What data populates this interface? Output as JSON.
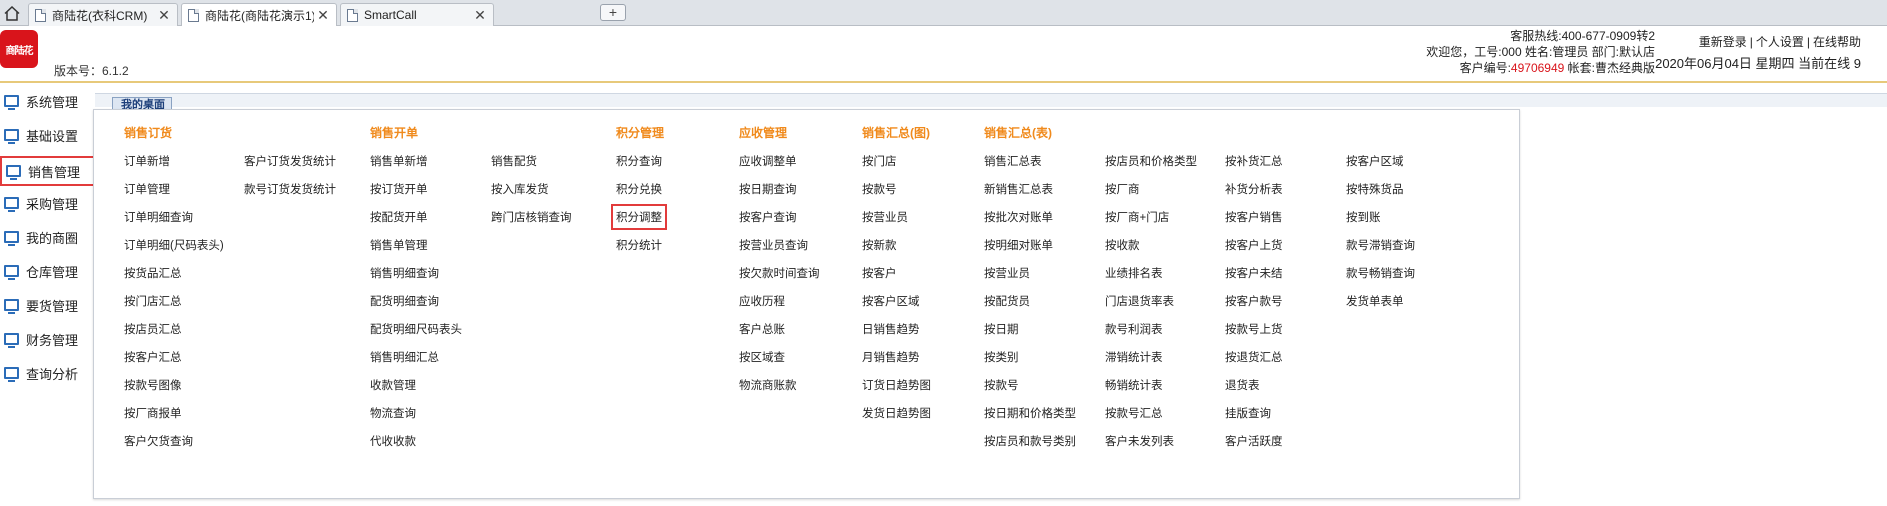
{
  "browser": {
    "tabs": [
      {
        "label": "商陆花(衣科CRM)"
      },
      {
        "label": "商陆花(商陆花演示1)"
      },
      {
        "label": "SmartCall"
      }
    ],
    "new_tab": "+"
  },
  "header": {
    "logo_text": "商陆花",
    "version": "版本号：6.1.2",
    "hotline": "客服热线:400-677-0909转2",
    "welcome": "欢迎您，工号:000 姓名:管理员 部门:默认店",
    "customer_prefix": "客户编号:",
    "customer_no": "49706949",
    "account": "帐套:曹杰经典版",
    "relogin": "重新登录",
    "personal": "个人设置",
    "help": "在线帮助",
    "sep": "|",
    "datetime_online": "2020年06月04日 星期四 当前在线 9"
  },
  "left_menu": [
    {
      "label": "系统管理"
    },
    {
      "label": "基础设置"
    },
    {
      "label": "销售管理"
    },
    {
      "label": "采购管理"
    },
    {
      "label": "我的商圈"
    },
    {
      "label": "仓库管理"
    },
    {
      "label": "要货管理"
    },
    {
      "label": "财务管理"
    },
    {
      "label": "查询分析"
    }
  ],
  "main_tab": "我的桌面",
  "dropdown": {
    "titles": [
      "销售订货",
      "销售开单",
      "积分管理",
      "应收管理",
      "销售汇总(图)",
      "销售汇总(表)"
    ],
    "c1": [
      "订单新增",
      "订单管理",
      "订单明细查询",
      "订单明细(尺码表头)",
      "按货品汇总",
      "按门店汇总",
      "按店员汇总",
      "按客户汇总",
      "按款号图像",
      "按厂商报单",
      "客户欠货查询"
    ],
    "c2": [
      "客户订货发货统计",
      "款号订货发货统计"
    ],
    "c3": [
      "销售单新增",
      "按订货开单",
      "按配货开单",
      "销售单管理",
      "销售明细查询",
      "配货明细查询",
      "配货明细尺码表头",
      "销售明细汇总",
      "收款管理",
      "物流查询",
      "代收收款"
    ],
    "c4": [
      "销售配货",
      "按入库发货",
      "跨门店核销查询"
    ],
    "c5": [
      "积分查询",
      "积分兑换",
      "积分调整",
      "积分统计"
    ],
    "c6": [
      "应收调整单",
      "按日期查询",
      "按客户查询",
      "按营业员查询",
      "按欠款时间查询",
      "应收历程",
      "客户总账",
      "按区域查",
      "物流商账款"
    ],
    "c7": [
      "按门店",
      "按款号",
      "按营业员",
      "按新款",
      "按客户",
      "按客户区域",
      "日销售趋势",
      "月销售趋势",
      "订货日趋势图",
      "发货日趋势图"
    ],
    "c8": [
      "销售汇总表",
      "新销售汇总表",
      "按批次对账单",
      "按明细对账单",
      "按营业员",
      "按配货员",
      "按日期",
      "按类别",
      "按款号",
      "按日期和价格类型",
      "按店员和款号类别"
    ],
    "c9": [
      "按店员和价格类型",
      "按厂商",
      "按厂商+门店",
      "按收款",
      "业绩排名表",
      "门店退货率表",
      "款号利润表",
      "滞销统计表",
      "畅销统计表",
      "按款号汇总",
      "客户未发列表"
    ],
    "c10": [
      "按补货汇总",
      "补货分析表",
      "按客户销售",
      "按客户上货",
      "按客户未结",
      "按客户款号",
      "按款号上货",
      "按退货汇总",
      "退货表",
      "挂版查询",
      "客户活跃度"
    ],
    "c11": [
      "按客户区域",
      "按特殊货品",
      "按到账",
      "款号滞销查询",
      "款号畅销查询",
      "发货单表单"
    ]
  },
  "colors": {
    "accent_title": "#f08a1c",
    "highlight": "#e23b3b",
    "brand_red": "#d9141b",
    "icon_blue": "#2b6cb8"
  }
}
